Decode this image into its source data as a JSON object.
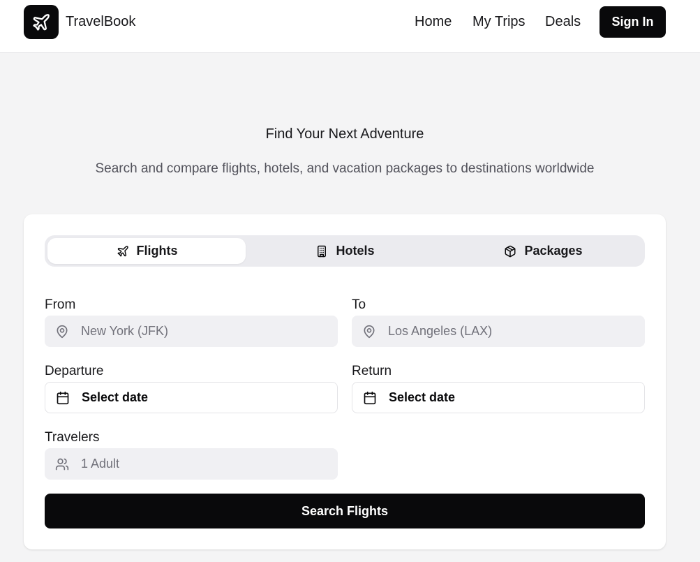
{
  "header": {
    "brand": "TravelBook",
    "nav": [
      "Home",
      "My Trips",
      "Deals"
    ],
    "signin_label": "Sign In"
  },
  "hero": {
    "title": "Find Your Next Adventure",
    "subtitle": "Search and compare flights, hotels, and vacation packages to destinations worldwide"
  },
  "tabs": [
    {
      "label": "Flights",
      "icon": "plane-icon",
      "active": true
    },
    {
      "label": "Hotels",
      "icon": "building-icon",
      "active": false
    },
    {
      "label": "Packages",
      "icon": "package-icon",
      "active": false
    }
  ],
  "form": {
    "from": {
      "label": "From",
      "placeholder": "New York (JFK)",
      "icon": "map-pin-icon"
    },
    "to": {
      "label": "To",
      "placeholder": "Los Angeles (LAX)",
      "icon": "map-pin-icon"
    },
    "departure": {
      "label": "Departure",
      "value": "Select date",
      "icon": "calendar-icon"
    },
    "return": {
      "label": "Return",
      "value": "Select date",
      "icon": "calendar-icon"
    },
    "travelers": {
      "label": "Travelers",
      "placeholder": "1 Adult",
      "icon": "users-icon"
    },
    "submit_label": "Search Flights"
  },
  "colors": {
    "primary": "#09090b",
    "background": "#f4f4f5",
    "input_bg": "#f0f0f3",
    "muted_text": "#71717a"
  }
}
